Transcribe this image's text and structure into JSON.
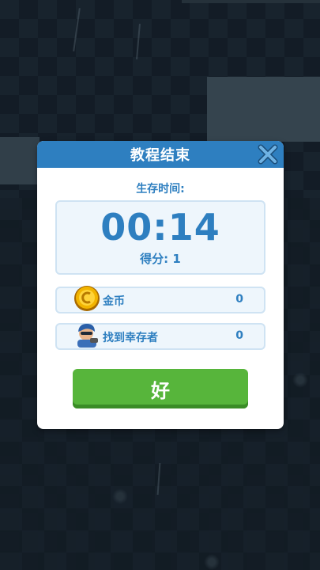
{
  "dialog": {
    "title": "教程结束",
    "survival_label": "生存时间:",
    "time": "00:14",
    "score": "得分: 1",
    "rows": [
      {
        "label": "金币",
        "value": "0",
        "icon": "gold-coin-icon"
      },
      {
        "label": "找到幸存者",
        "value": "0",
        "icon": "survivor-icon"
      }
    ],
    "ok_label": "好"
  },
  "colors": {
    "header": "#2e7fc0",
    "text_blue": "#2e7fc0",
    "ok_green": "#57b53b",
    "panel_bg": "#eef6fc"
  }
}
